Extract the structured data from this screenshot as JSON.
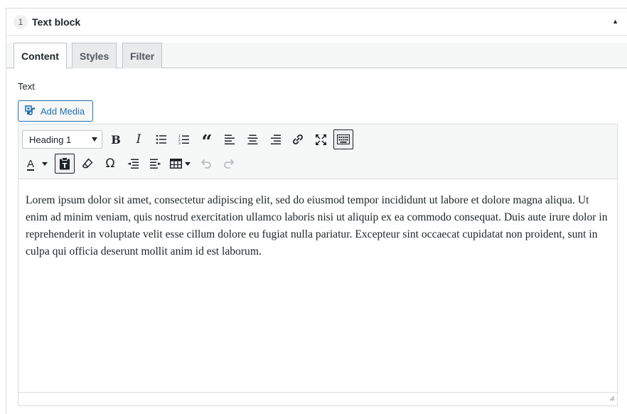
{
  "panel": {
    "number": "1",
    "title": "Text block",
    "toggle_glyph": "▲"
  },
  "tabs": [
    {
      "label": "Content",
      "active": true
    },
    {
      "label": "Styles",
      "active": false
    },
    {
      "label": "Filter",
      "active": false
    }
  ],
  "field": {
    "label": "Text"
  },
  "add_media": {
    "label": "Add Media",
    "icon": "media-icon"
  },
  "toolbar": {
    "format_select": {
      "selected": "Heading 1"
    },
    "row1_icons": [
      "bold-icon",
      "italic-icon",
      "bullet-list-icon",
      "numbered-list-icon",
      "blockquote-icon",
      "align-left-icon",
      "align-center-icon",
      "align-right-icon",
      "link-icon",
      "fullscreen-icon",
      "toolbar-toggle-icon"
    ],
    "row2_icons": [
      "text-color-icon",
      "paste-as-text-icon",
      "clear-formatting-icon",
      "special-character-icon",
      "outdent-icon",
      "indent-icon",
      "table-icon",
      "undo-icon",
      "redo-icon"
    ],
    "bold_glyph": "B",
    "italic_glyph": "I",
    "text_color_glyph": "A",
    "omega_glyph": "Ω",
    "quote_glyph": "“",
    "accent_color": "#2271b1"
  },
  "editor": {
    "content": "Lorem ipsum dolor sit amet, consectetur adipiscing elit, sed do eiusmod tempor incididunt ut labore et dolore magna aliqua. Ut enim ad minim veniam, quis nostrud exercitation ullamco laboris nisi ut aliquip ex ea commodo consequat. Duis aute irure dolor in reprehenderit in voluptate velit esse cillum dolore eu fugiat nulla pariatur. Excepteur sint occaecat cupidatat non proident, sunt in culpa qui officia deserunt mollit anim id est laborum."
  }
}
